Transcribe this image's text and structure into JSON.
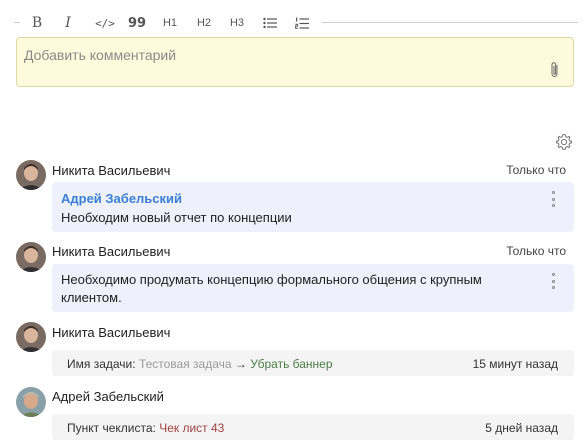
{
  "toolbar": {
    "bold": "B",
    "italic": "I",
    "code": "</>",
    "quote": "99",
    "h1": "H1",
    "h2": "H2",
    "h3": "H3"
  },
  "comment": {
    "placeholder": "Добавить комментарий"
  },
  "feed": [
    {
      "author": "Никита Васильевич",
      "time": "Только что",
      "mention": "Адрей Забельский",
      "text": "Необходим новый отчет по концепции"
    },
    {
      "author": "Никита Васильевич",
      "time": "Только что",
      "text": "Необходимо продумать концепцию формального общения с крупным клиентом."
    },
    {
      "author": "Никита Васильевич",
      "event_label": "Имя задачи:",
      "old_value": "Тестовая задача",
      "arrow": "→",
      "new_value": "Убрать баннер",
      "time": "15 минут назад"
    },
    {
      "author": "Адрей Забельский",
      "event_label": "Пункт чеклиста:",
      "value": "Чек лист 43",
      "time": "5 дней назад"
    }
  ]
}
